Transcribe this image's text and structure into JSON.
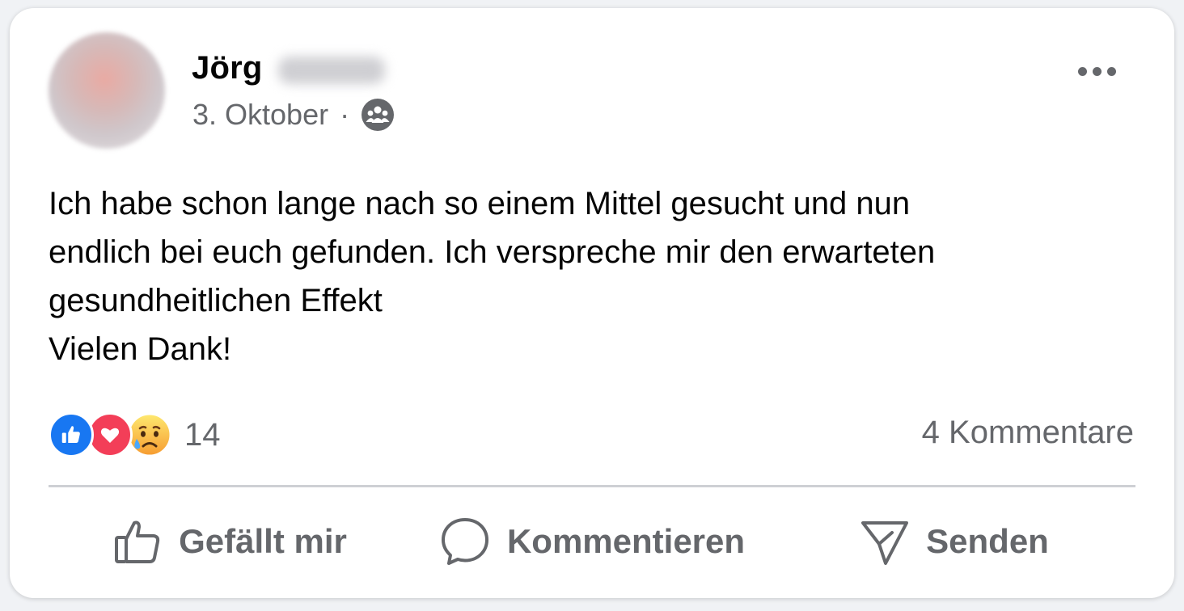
{
  "post": {
    "author_name": "Jörg",
    "date": "3. Oktober",
    "separator": "·",
    "audience_icon": "group-icon",
    "body": "Ich habe schon lange nach so einem Mittel gesucht und nun\nendlich bei euch gefunden. Ich verspreche mir den erwarteten\ngesundheitlichen Effekt\nVielen Dank!"
  },
  "reactions": {
    "icons": [
      "like-icon",
      "love-icon",
      "sad-icon"
    ],
    "count": "14"
  },
  "comments": {
    "label": "4 Kommentare"
  },
  "actions": {
    "like_label": "Gefällt mir",
    "comment_label": "Kommentieren",
    "send_label": "Senden"
  },
  "colors": {
    "like_blue": "#1877f2",
    "love_red": "#f33e58",
    "secondary_text": "#65676b",
    "primary_text": "#050505"
  }
}
